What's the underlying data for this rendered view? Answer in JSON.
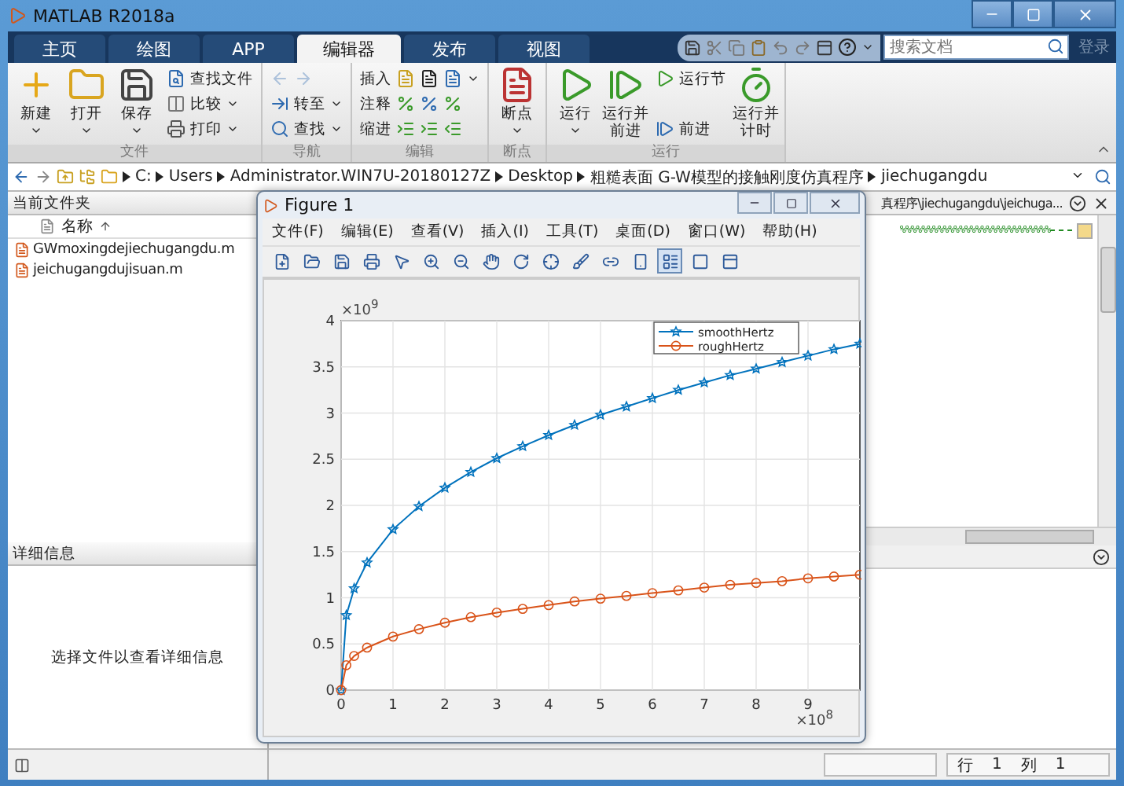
{
  "window": {
    "title": "MATLAB R2018a"
  },
  "tabs": [
    {
      "label": "主页",
      "selected": false
    },
    {
      "label": "绘图",
      "selected": false
    },
    {
      "label": "APP",
      "selected": false
    },
    {
      "label": "编辑器",
      "selected": true
    },
    {
      "label": "发布",
      "selected": false
    },
    {
      "label": "视图",
      "selected": false
    }
  ],
  "quick_access": {
    "search": {
      "placeholder": "搜索文档"
    },
    "login": "登录"
  },
  "ribbon": {
    "groups": [
      {
        "label": "文件",
        "items": [
          {
            "kind": "large",
            "label": "新建",
            "dropdown": true
          },
          {
            "kind": "large",
            "label": "打开",
            "dropdown": true
          },
          {
            "kind": "large",
            "label": "保存",
            "dropdown": true
          },
          {
            "kind": "column",
            "rows": [
              {
                "label": "查找文件",
                "dropdown": false
              },
              {
                "label": "比较",
                "dropdown": true
              },
              {
                "label": "打印",
                "dropdown": true
              }
            ]
          }
        ]
      },
      {
        "label": "导航",
        "items": [
          {
            "kind": "column",
            "rows": [
              {
                "kind": "arrows",
                "disabled": true
              },
              {
                "label": "转至",
                "dropdown": true
              },
              {
                "label": "查找",
                "dropdown": true
              }
            ]
          }
        ]
      },
      {
        "label": "编辑",
        "items": [
          {
            "kind": "column",
            "rows": [
              {
                "label": "插入",
                "dropdown": true
              },
              {
                "label": "注释",
                "dropdown": false
              },
              {
                "label": "缩进",
                "dropdown": false
              }
            ]
          }
        ]
      },
      {
        "label": "断点",
        "items": [
          {
            "kind": "large",
            "label": "断点",
            "dropdown": true
          }
        ]
      },
      {
        "label": "运行",
        "items": [
          {
            "kind": "large",
            "label": "运行",
            "dropdown": true
          },
          {
            "kind": "large",
            "label": "运行并前进",
            "dropdown": false
          },
          {
            "kind": "column",
            "rows": [
              {
                "label": "运行节",
                "dropdown": false
              },
              {
                "label": "前进",
                "dropdown": false
              }
            ]
          },
          {
            "kind": "large",
            "label": "运行并计时",
            "dropdown": false
          }
        ]
      }
    ]
  },
  "address": {
    "path": [
      "C:",
      "Users",
      "Administrator.WIN7U-20180127Z",
      "Desktop",
      "粗糙表面 G-W模型的接触刚度仿真程序",
      "jiechugangdu"
    ]
  },
  "current_folder": {
    "title": "当前文件夹",
    "column": "名称",
    "files": [
      "GWmoxingdejiechugangdu.m",
      "jeichugangdujisuan.m"
    ]
  },
  "details": {
    "title": "详细信息",
    "message": "选择文件以查看详细信息"
  },
  "editor": {
    "path": "真程序\\jiechugangdu\\jeichuga...",
    "code_line": "%%%%%%%%%%%%%%%%%%%%%%%%%%%%"
  },
  "figure": {
    "title": "Figure 1",
    "menus": [
      "文件(F)",
      "编辑(E)",
      "查看(V)",
      "插入(I)",
      "工具(T)",
      "桌面(D)",
      "窗口(W)",
      "帮助(H)"
    ],
    "y_exponent": "×10$^{9}$",
    "x_exponent": "×10$^{8}$",
    "chart_data": {
      "type": "line",
      "x": [
        0,
        0.1,
        0.25,
        0.5,
        1,
        1.5,
        2,
        2.5,
        3,
        3.5,
        4,
        4.5,
        5,
        5.5,
        6,
        6.5,
        7,
        7.5,
        8,
        8.5,
        9,
        9.5,
        10
      ],
      "series": [
        {
          "name": "smoothHertz",
          "color": "#0072bd",
          "marker": "star",
          "values": [
            0,
            0.81,
            1.1,
            1.38,
            1.74,
            1.99,
            2.19,
            2.36,
            2.51,
            2.64,
            2.76,
            2.87,
            2.98,
            3.07,
            3.16,
            3.25,
            3.33,
            3.41,
            3.48,
            3.55,
            3.62,
            3.69,
            3.75
          ]
        },
        {
          "name": "roughHertz",
          "color": "#d95319",
          "marker": "circle",
          "values": [
            0,
            0.27,
            0.37,
            0.46,
            0.58,
            0.66,
            0.73,
            0.79,
            0.84,
            0.88,
            0.92,
            0.96,
            0.99,
            1.02,
            1.05,
            1.08,
            1.11,
            1.14,
            1.16,
            1.18,
            1.21,
            1.23,
            1.25
          ]
        }
      ],
      "grid": true,
      "legend": true,
      "xlim": [
        0,
        10
      ],
      "ylim": [
        0,
        4
      ],
      "xticks": [
        0,
        1,
        2,
        3,
        4,
        5,
        6,
        7,
        8,
        9
      ],
      "yticks": [
        0,
        0.5,
        1,
        1.5,
        2,
        2.5,
        3,
        3.5,
        4
      ]
    }
  },
  "status_bar": {
    "row_label": "行",
    "row": "1",
    "col_label": "列",
    "col": "1"
  }
}
